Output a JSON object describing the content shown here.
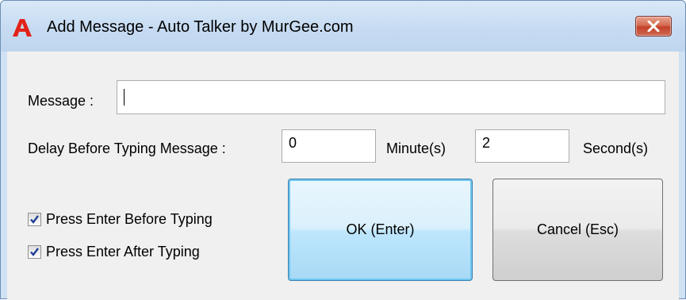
{
  "window": {
    "title": "Add Message - Auto Talker by MurGee.com",
    "app_icon": "red-letter-a-icon",
    "close_icon": "close-x-icon"
  },
  "form": {
    "message_label": "Message :",
    "message_value": "",
    "delay_label": "Delay Before Typing Message :",
    "minutes_value": "0",
    "minutes_label": "Minute(s)",
    "seconds_value": "2",
    "seconds_label": "Second(s)"
  },
  "options": {
    "press_enter_before": {
      "label": "Press Enter Before Typing",
      "checked": true
    },
    "press_enter_after": {
      "label": "Press Enter After Typing",
      "checked": true
    }
  },
  "buttons": {
    "ok_label": "OK (Enter)",
    "cancel_label": "Cancel (Esc)"
  },
  "colors": {
    "title_bar": "#c6dbf2",
    "close_button": "#c3412a",
    "app_icon": "#e2231a",
    "checkbox_check": "#1d3f95",
    "default_button_border": "#3c7fb1"
  }
}
